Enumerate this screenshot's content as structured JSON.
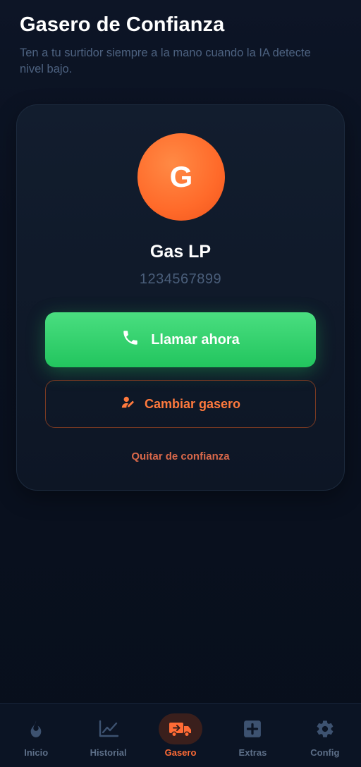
{
  "header": {
    "title": "Gasero de Confianza",
    "subtitle": "Ten a tu surtidor siempre a la mano cuando la IA detecte nivel bajo."
  },
  "card": {
    "avatar_initial": "G",
    "name": "Gas LP",
    "phone": "1234567899",
    "call_label": "Llamar ahora",
    "change_label": "Cambiar gasero",
    "remove_label": "Quitar de confianza"
  },
  "nav": {
    "items": [
      {
        "label": "Inicio",
        "icon": "flame-icon"
      },
      {
        "label": "Historial",
        "icon": "chart-line-icon"
      },
      {
        "label": "Gasero",
        "icon": "truck-icon",
        "active": true
      },
      {
        "label": "Extras",
        "icon": "plus-square-icon"
      },
      {
        "label": "Config",
        "icon": "gear-icon"
      }
    ]
  },
  "colors": {
    "accent": "#ff6b35",
    "call_button": "#22c55e",
    "background": "#0a1120"
  }
}
